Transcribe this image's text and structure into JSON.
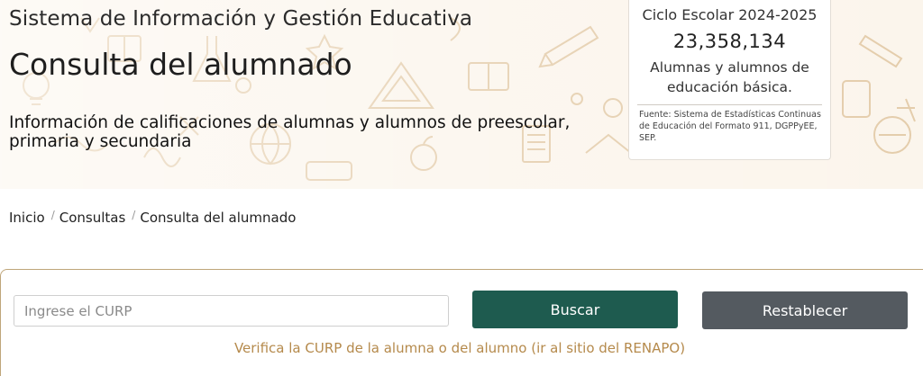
{
  "header": {
    "system_title": "Sistema de Información y Gestión Educativa",
    "page_title": "Consulta del alumnado",
    "subtitle": "Información de calificaciones de alumnas y alumnos de preescolar, primaria y secundaria"
  },
  "stats": {
    "cycle": "Ciclo Escolar 2024-2025",
    "count": "23,358,134",
    "description": "Alumnas y alumnos de educación básica.",
    "source": "Fuente: Sistema de Estadísticas Continuas de Educación del Formato 911, DGPPyEE, SEP."
  },
  "breadcrumb": {
    "items": [
      "Inicio",
      "Consultas",
      "Consulta del alumnado"
    ],
    "separator": "/"
  },
  "search": {
    "placeholder": "Ingrese el CURP",
    "value": "",
    "search_label": "Buscar",
    "reset_label": "Restablecer",
    "verify_link": "Verifica la CURP de la alumna o del alumno (ir al sitio del RENAPO)"
  },
  "colors": {
    "primary": "#1e5b4f",
    "secondary": "#545a60",
    "accent_gold": "#b58a4c",
    "hero_bg": "#fbf4ea",
    "doodle": "#d9b98a"
  },
  "icons": {
    "hero_pattern": "school-doodle-pattern"
  }
}
